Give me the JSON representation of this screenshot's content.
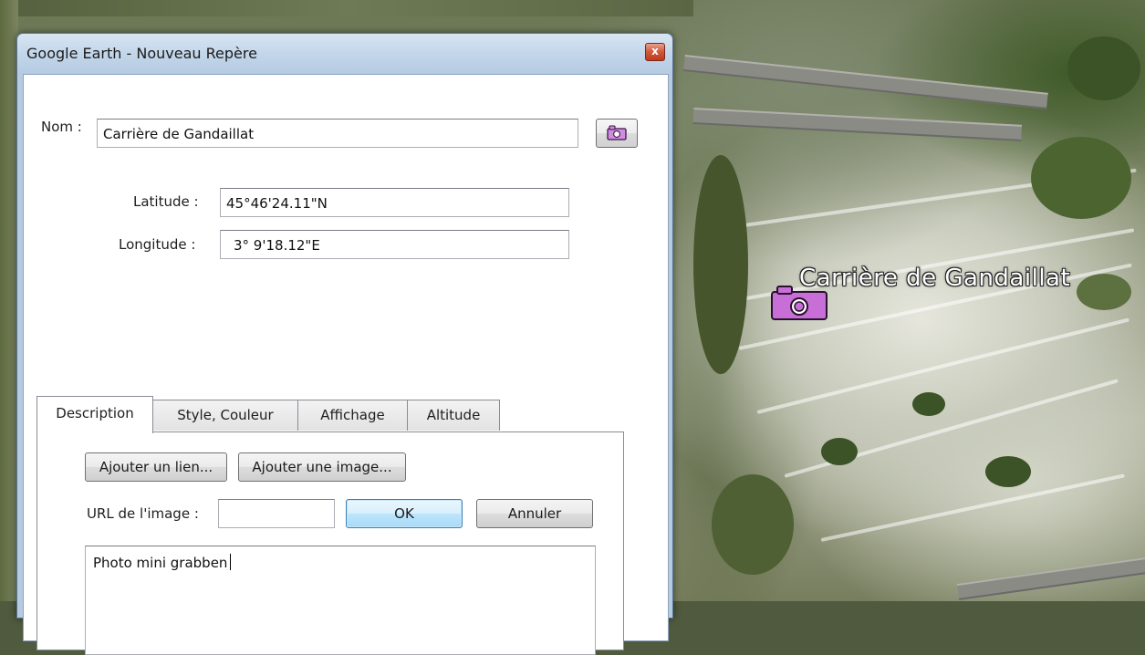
{
  "window": {
    "title": "Google Earth - Nouveau Repère",
    "close_glyph": "x"
  },
  "form": {
    "name_label": "Nom :",
    "name_value": "Carrière de Gandaillat",
    "latitude_label": "Latitude :",
    "latitude_value": "45°46'24.11\"N",
    "longitude_label": "Longitude :",
    "longitude_value": "3° 9'18.12\"E"
  },
  "tabs": [
    {
      "label": "Description",
      "active": true
    },
    {
      "label": "Style, Couleur",
      "active": false
    },
    {
      "label": "Affichage",
      "active": false
    },
    {
      "label": "Altitude",
      "active": false
    }
  ],
  "description_panel": {
    "add_link_label": "Ajouter un lien...",
    "add_image_label": "Ajouter une image...",
    "image_url_label": "URL de l'image :",
    "image_url_value": "",
    "ok_label": "OK",
    "cancel_label": "Annuler",
    "description_text": "Photo mini grabben"
  },
  "map": {
    "placemark_label": "Carrière de Gandaillat",
    "placemark_icon": "camera-icon",
    "placemark_color": "#c76fd6"
  }
}
